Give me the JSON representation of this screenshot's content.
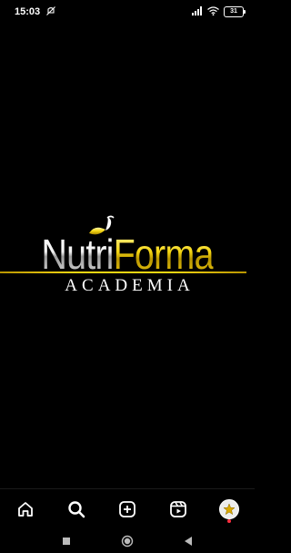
{
  "status_bar": {
    "time": "15:03",
    "battery": "31",
    "icons": [
      "mute-icon",
      "signal-icon",
      "wifi-icon",
      "battery-icon"
    ]
  },
  "logo": {
    "part1": "Nutri",
    "part2": "Forma",
    "subtitle": "ACADEMIA",
    "colors": {
      "gold": "#f5d612",
      "silver": "#e0e0e0"
    }
  },
  "bottom_nav": {
    "items": [
      {
        "icon": "home-icon"
      },
      {
        "icon": "search-icon"
      },
      {
        "icon": "create-post-icon"
      },
      {
        "icon": "reels-icon"
      },
      {
        "icon": "profile-avatar"
      }
    ]
  },
  "system_nav": {
    "items": [
      "recents-button",
      "home-button",
      "back-button"
    ]
  }
}
